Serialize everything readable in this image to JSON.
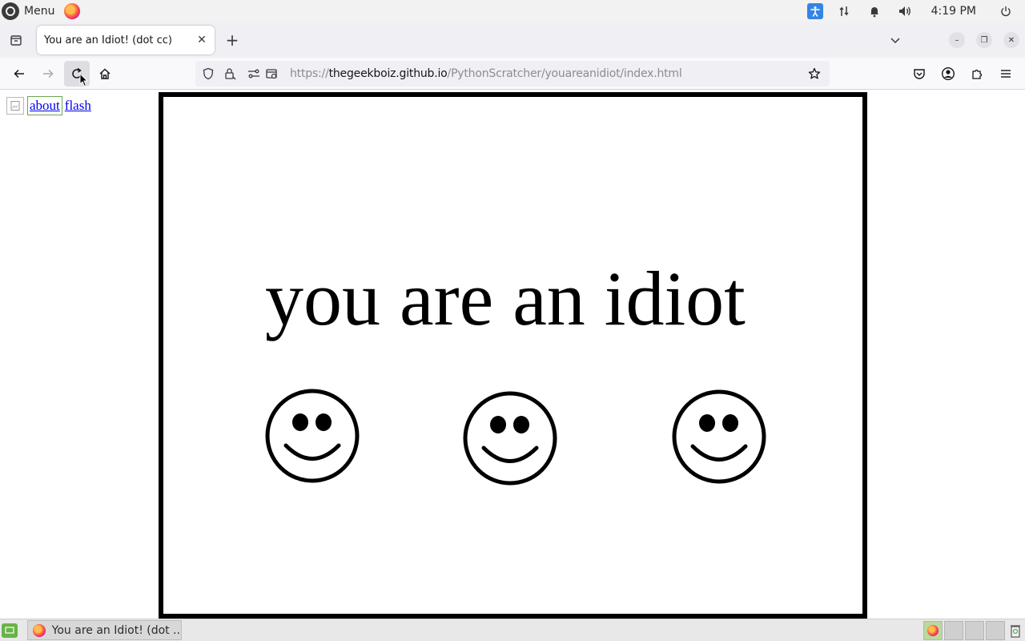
{
  "os_panel": {
    "menu_label": "Menu",
    "clock": "4:19 PM",
    "tray_icons": [
      "accessibility-icon",
      "network-icon",
      "notification-bell-icon",
      "volume-icon",
      "power-icon"
    ]
  },
  "browser": {
    "tab": {
      "title": "You are an Idiot! (dot cc)"
    },
    "url": {
      "scheme": "https://",
      "host": "thegeekboiz.github.io",
      "path": "/PythonScratcher/youareanidiot/index.html"
    }
  },
  "page": {
    "links": [
      "about",
      "flash"
    ],
    "headline": "you are an idiot",
    "smiley_count": 3
  },
  "taskbar": {
    "window_title": "You are an Idiot! (dot ..."
  },
  "colors": {
    "link": "#0000ee",
    "frame_border": "#000000",
    "accessibility_badge": "#3584e4",
    "taskbar_start": "#69b346"
  }
}
